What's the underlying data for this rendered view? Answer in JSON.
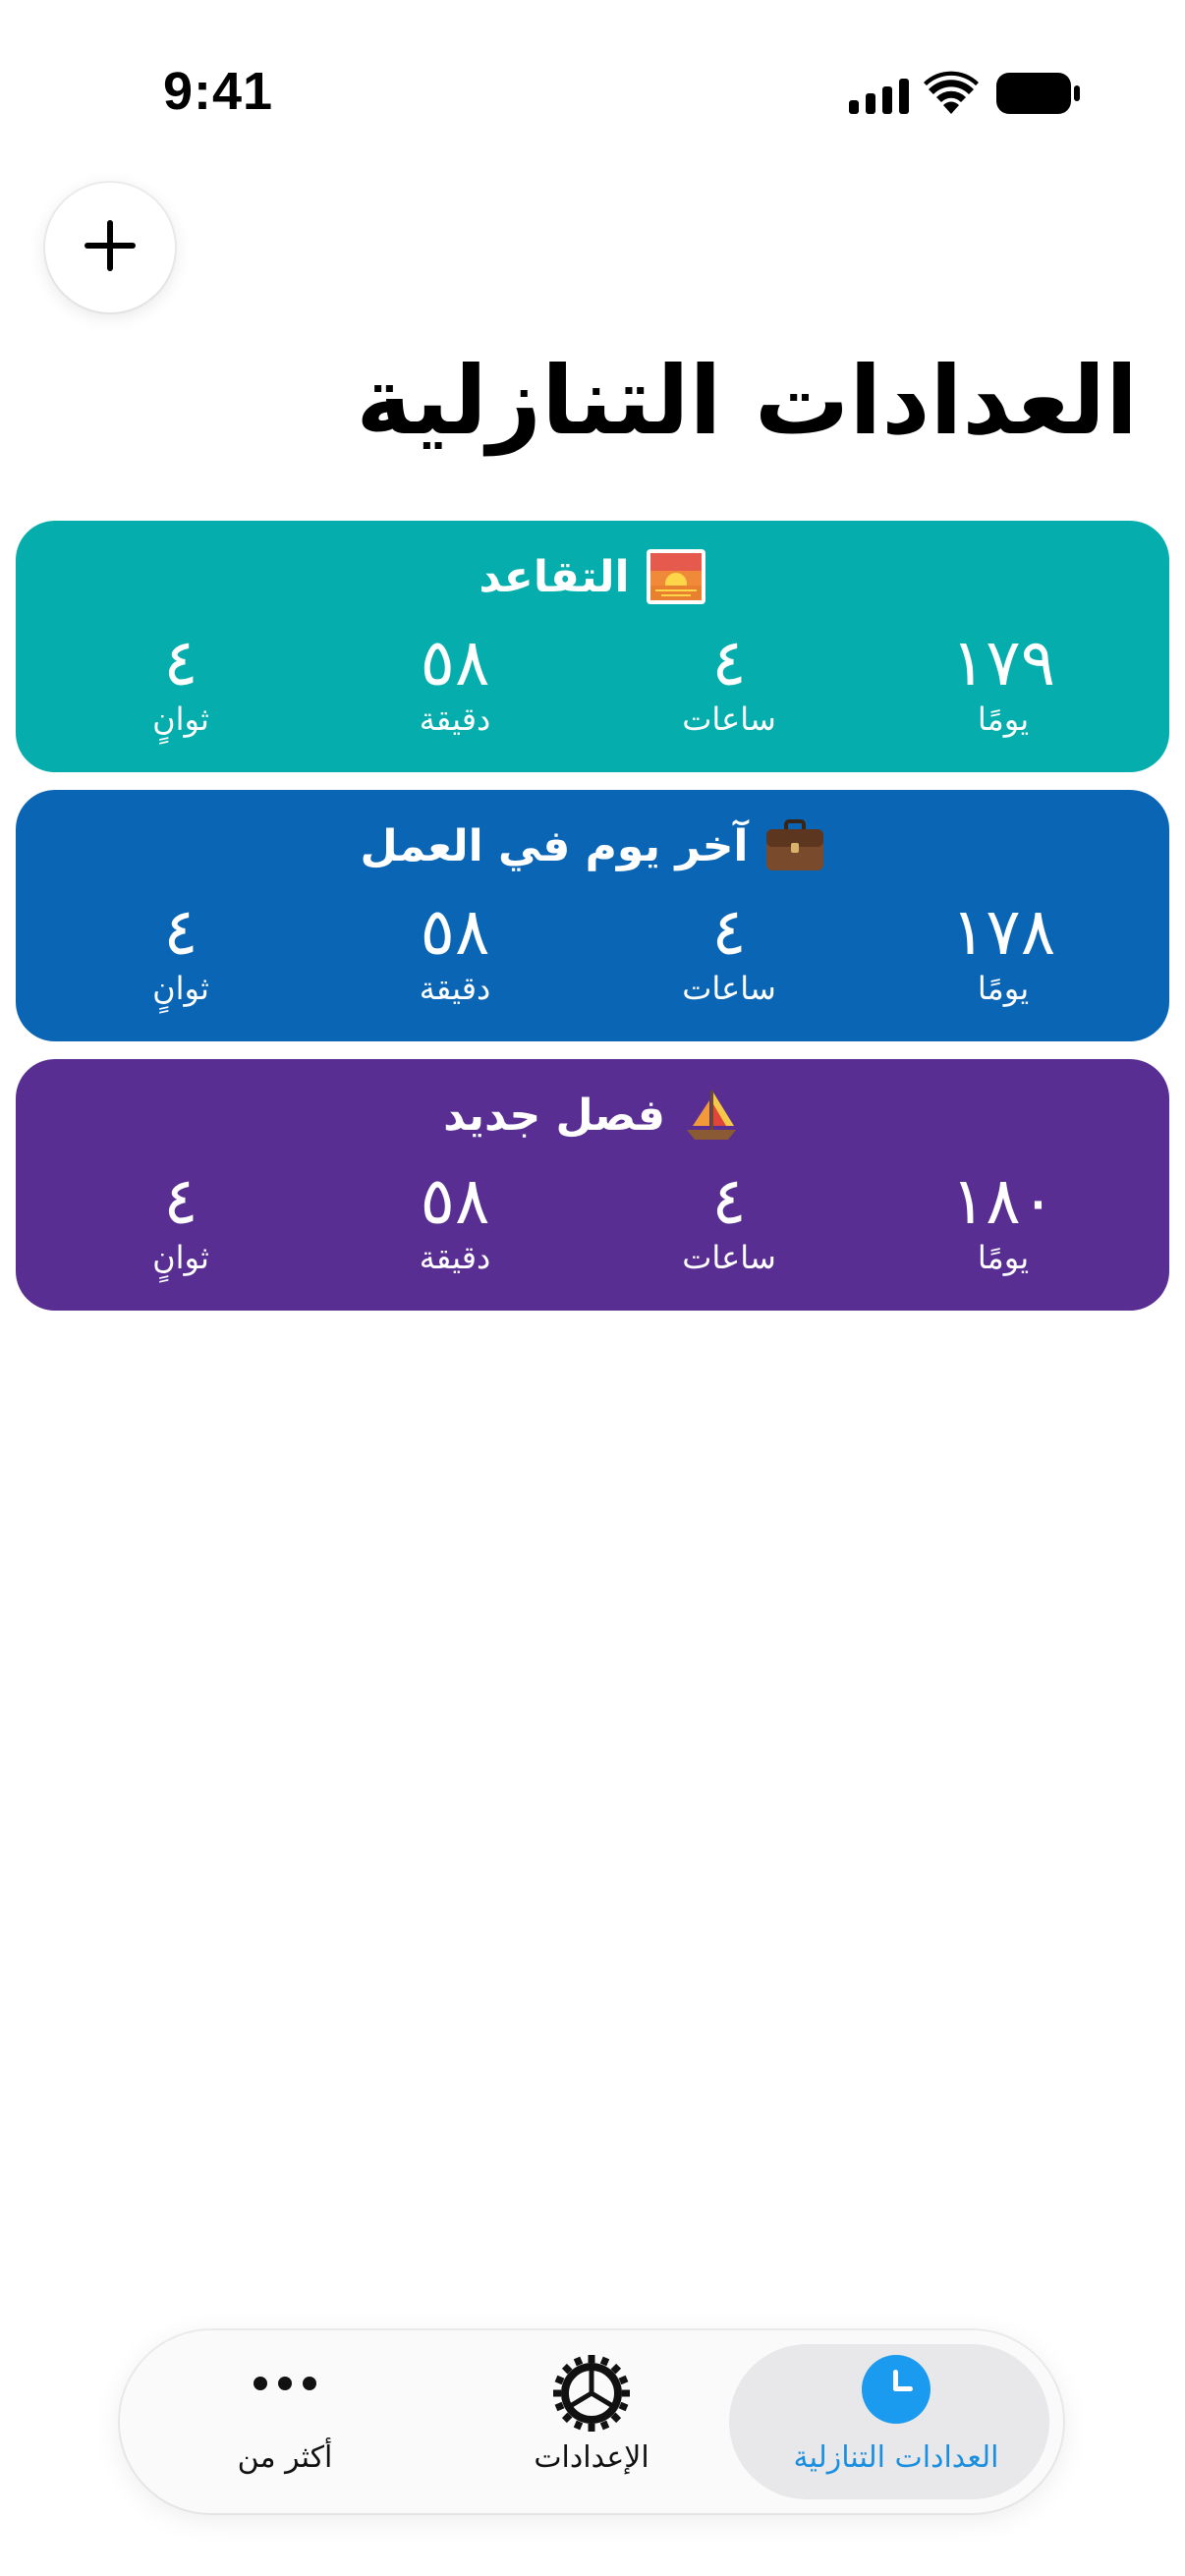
{
  "status_bar": {
    "time": "9:41",
    "icons": [
      "signal-icon",
      "wifi-icon",
      "battery-icon"
    ]
  },
  "header": {
    "add_icon": "plus-icon",
    "title": "العدادات التنازلية"
  },
  "timers": [
    {
      "title": "التقاعد",
      "emoji": "sunrise",
      "color": "#05ADAD",
      "days": "١٧٩",
      "hours": "٤",
      "minutes": "٥٨",
      "seconds": "٤",
      "labels": {
        "days": "يومًا",
        "hours": "ساعات",
        "minutes": "دقيقة",
        "seconds": "ثوانٍ"
      }
    },
    {
      "title": "آخر يوم في العمل",
      "emoji": "briefcase",
      "color": "#0A66B5",
      "days": "١٧٨",
      "hours": "٤",
      "minutes": "٥٨",
      "seconds": "٤",
      "labels": {
        "days": "يومًا",
        "hours": "ساعات",
        "minutes": "دقيقة",
        "seconds": "ثوانٍ"
      }
    },
    {
      "title": "فصل جديد",
      "emoji": "sailboat",
      "color": "#582E92",
      "days": "١٨٠",
      "hours": "٤",
      "minutes": "٥٨",
      "seconds": "٤",
      "labels": {
        "days": "يومًا",
        "hours": "ساعات",
        "minutes": "دقيقة",
        "seconds": "ثوانٍ"
      }
    }
  ],
  "tab_bar": {
    "active_color": "#1A9BF0",
    "items": [
      {
        "label": "العدادات التنازلية",
        "icon": "clock-icon",
        "active": true
      },
      {
        "label": "الإعدادات",
        "icon": "gear-icon",
        "active": false
      },
      {
        "label": "أكثر من",
        "icon": "more-icon",
        "active": false
      }
    ]
  }
}
